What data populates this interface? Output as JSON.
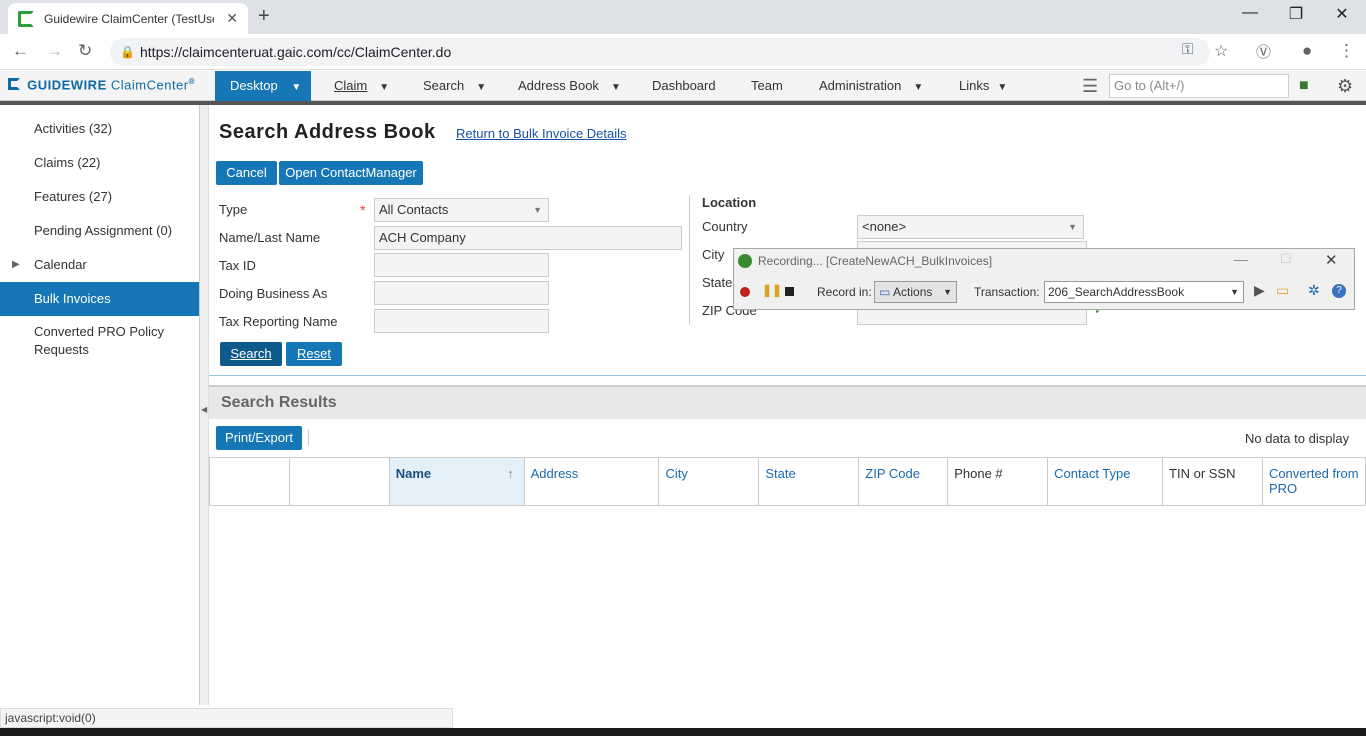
{
  "browser": {
    "tab_title": "Guidewire ClaimCenter (TestUser",
    "url": "https://claimcenteruat.gaic.com/cc/ClaimCenter.do"
  },
  "app": {
    "logo_brand": "GUIDEWIRE",
    "logo_product": "ClaimCenter",
    "nav": [
      "Desktop",
      "Claim",
      "Search",
      "Address Book",
      "Dashboard",
      "Team",
      "Administration",
      "Links"
    ],
    "goto_placeholder": "Go to (Alt+/)"
  },
  "sidebar": {
    "items": [
      {
        "label": "Activities (32)"
      },
      {
        "label": "Claims (22)"
      },
      {
        "label": "Features (27)"
      },
      {
        "label": "Pending Assignment (0)"
      },
      {
        "label": "Calendar"
      },
      {
        "label": "Bulk Invoices"
      },
      {
        "label": "Converted PRO Policy Requests"
      }
    ]
  },
  "page": {
    "title": "Search Address Book",
    "return_link": "Return to Bulk Invoice Details",
    "cancel": "Cancel",
    "open_cm": "Open ContactManager",
    "search": "Search",
    "reset": "Reset"
  },
  "form": {
    "type_label": "Type",
    "type_value": "All Contacts",
    "name_label": "Name/Last Name",
    "name_value": "ACH Company",
    "taxid_label": "Tax ID",
    "dba_label": "Doing Business As",
    "taxrep_label": "Tax Reporting Name",
    "location_label": "Location",
    "country_label": "Country",
    "country_value": "<none>",
    "city_label": "City",
    "state_label": "State",
    "zip_label": "ZIP Code"
  },
  "recorder": {
    "title": "Recording... [CreateNewACH_BulkInvoices]",
    "record_in_label": "Record in:",
    "record_in_value": "Actions",
    "transaction_label": "Transaction:",
    "transaction_value": "206_SearchAddressBook"
  },
  "results": {
    "title": "Search Results",
    "print": "Print/Export",
    "empty": "No data to display",
    "columns": [
      "Name",
      "Address",
      "City",
      "State",
      "ZIP Code",
      "Phone #",
      "Contact Type",
      "TIN or SSN",
      "Converted from PRO"
    ]
  },
  "status": "javascript:void(0)"
}
